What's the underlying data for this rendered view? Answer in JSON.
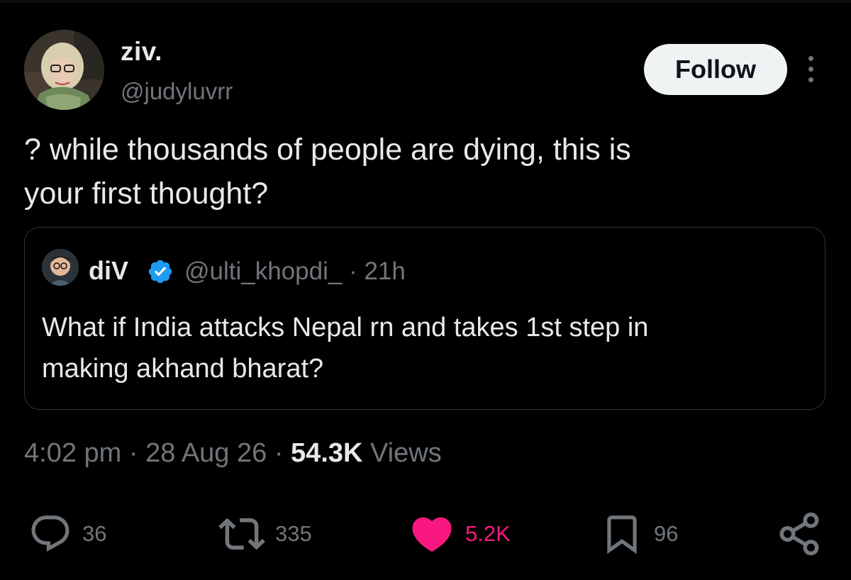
{
  "author": {
    "display_name": "ziv.",
    "handle": "@judyluvrr"
  },
  "follow_label": "Follow",
  "tweet": {
    "line1": "? while thousands of people are dying, this is",
    "line2": "your first thought?"
  },
  "quoted": {
    "display_name": "diV",
    "handle_time": "@ulti_khopdi_ · 21h",
    "line1": "What if India attacks Nepal rn and takes 1st step in",
    "line2": "making akhand bharat?"
  },
  "meta": {
    "time": "4:02 pm",
    "date": "28 Aug 26",
    "views_count": "54.3K",
    "views_label": "Views",
    "separator": "·"
  },
  "actions": {
    "replies": "36",
    "retweets": "335",
    "likes": "5.2K",
    "bookmarks": "96"
  },
  "colors": {
    "like": "#f91880",
    "verified": "#1d9bf0",
    "muted": "#71767b"
  }
}
